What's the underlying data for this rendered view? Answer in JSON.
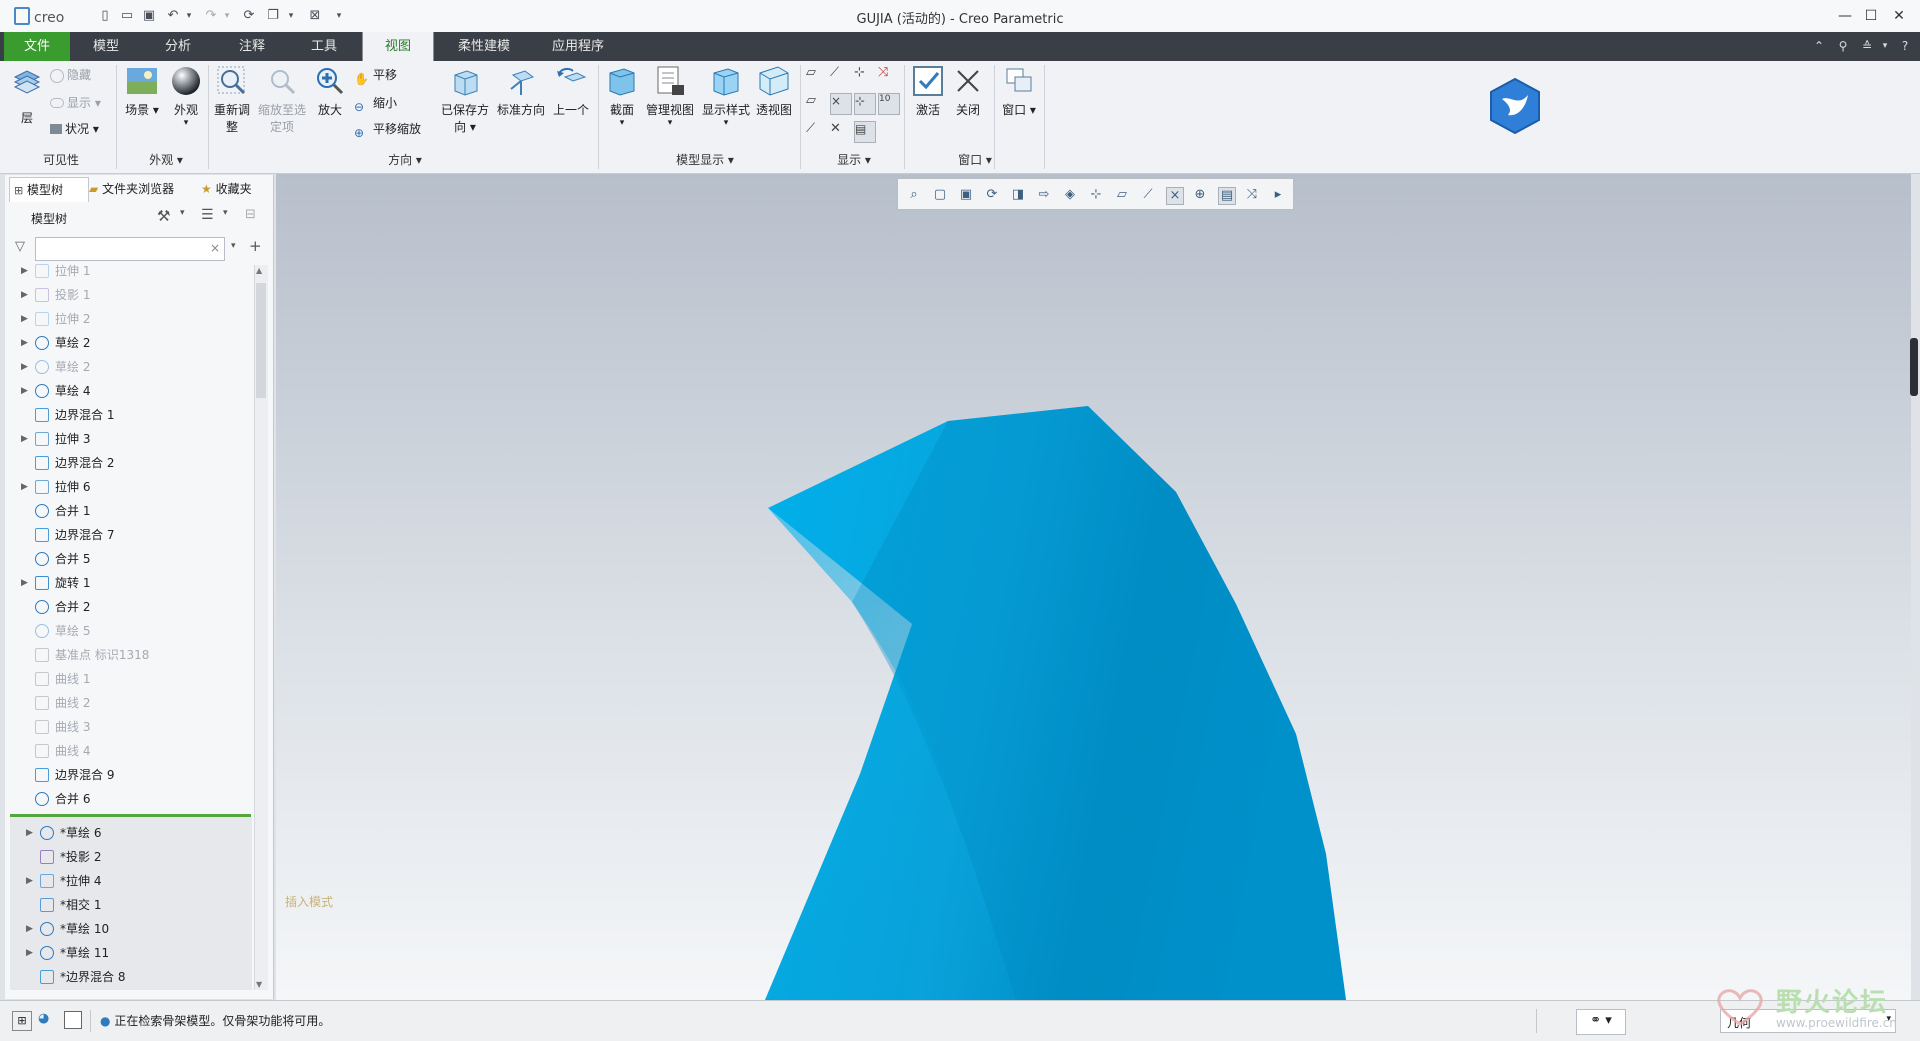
{
  "window": {
    "app_logo": "creo",
    "title": "GUJIA (活动的) - Creo Parametric"
  },
  "menu": {
    "tabs": [
      {
        "label": "文件"
      },
      {
        "label": "模型"
      },
      {
        "label": "分析"
      },
      {
        "label": "注释"
      },
      {
        "label": "工具"
      },
      {
        "label": "视图"
      },
      {
        "label": "柔性建模"
      },
      {
        "label": "应用程序"
      }
    ],
    "active_tab": "视图"
  },
  "ribbon": {
    "visibility": {
      "layer": "层",
      "hide": "隐藏",
      "show": "显示",
      "status": "状况",
      "group": "可见性"
    },
    "appearance": {
      "scene": "场景",
      "appearance": "外观",
      "group": "外观"
    },
    "orientation": {
      "refit_line1": "重新调",
      "refit_line2": "整",
      "zoom_selected_line1": "缩放至选",
      "zoom_selected_line2": "定项",
      "zoom_in": "放大",
      "pan": "平移",
      "zoom_out": "缩小",
      "pan_zoom": "平移缩放",
      "saved_line1": "已保存方",
      "saved_line2": "向",
      "standard": "标准方向",
      "previous": "上一个",
      "group": "方向"
    },
    "model_display": {
      "section": "截面",
      "manage_views": "管理视图",
      "display_style": "显示样式",
      "perspective": "透视图",
      "group": "模型显示"
    },
    "display": {
      "group": "显示"
    },
    "window_group": {
      "activate": "激活",
      "close": "关闭",
      "windows": "窗口",
      "group": "窗口"
    }
  },
  "left_panel": {
    "tabs": [
      {
        "label": "模型树"
      },
      {
        "label": "文件夹浏览器"
      },
      {
        "label": "收藏夹"
      }
    ],
    "header": "模型树",
    "tree": [
      {
        "label": "拉伸 1",
        "dim": true,
        "arrow": true,
        "icon": "extrude-icon"
      },
      {
        "label": "投影 1",
        "dim": true,
        "arrow": true,
        "icon": "projection-icon"
      },
      {
        "label": "拉伸 2",
        "dim": true,
        "arrow": true,
        "icon": "extrude-icon"
      },
      {
        "label": "草绘 2",
        "dim": false,
        "arrow": true,
        "icon": "sketch-icon"
      },
      {
        "label": "草绘 2",
        "dim": true,
        "arrow": true,
        "icon": "sketch-icon"
      },
      {
        "label": "草绘 4",
        "dim": false,
        "arrow": true,
        "icon": "sketch-icon"
      },
      {
        "label": "边界混合 1",
        "dim": false,
        "arrow": false,
        "icon": "boundary-blend-icon"
      },
      {
        "label": "拉伸 3",
        "dim": false,
        "arrow": true,
        "icon": "extrude-icon"
      },
      {
        "label": "边界混合 2",
        "dim": false,
        "arrow": false,
        "icon": "boundary-blend-icon"
      },
      {
        "label": "拉伸 6",
        "dim": false,
        "arrow": true,
        "icon": "extrude-icon"
      },
      {
        "label": "合并 1",
        "dim": false,
        "arrow": false,
        "icon": "merge-icon"
      },
      {
        "label": "边界混合 7",
        "dim": false,
        "arrow": false,
        "icon": "boundary-blend-icon"
      },
      {
        "label": "合并 5",
        "dim": false,
        "arrow": false,
        "icon": "merge-icon"
      },
      {
        "label": "旋转 1",
        "dim": false,
        "arrow": true,
        "icon": "revolve-icon"
      },
      {
        "label": "合并 2",
        "dim": false,
        "arrow": false,
        "icon": "merge-icon"
      },
      {
        "label": "草绘 5",
        "dim": true,
        "arrow": false,
        "icon": "sketch-icon"
      },
      {
        "label": "基准点 标识1318",
        "dim": true,
        "arrow": false,
        "icon": "datum-point-icon"
      },
      {
        "label": "曲线 1",
        "dim": true,
        "arrow": false,
        "icon": "curve-icon"
      },
      {
        "label": "曲线 2",
        "dim": true,
        "arrow": false,
        "icon": "curve-icon"
      },
      {
        "label": "曲线 3",
        "dim": true,
        "arrow": false,
        "icon": "curve-icon"
      },
      {
        "label": "曲线 4",
        "dim": true,
        "arrow": false,
        "icon": "curve-icon"
      },
      {
        "label": "边界混合 9",
        "dim": false,
        "arrow": false,
        "icon": "boundary-blend-icon"
      },
      {
        "label": "合并 6",
        "dim": false,
        "arrow": false,
        "icon": "merge-icon"
      }
    ],
    "tree_after_insert": [
      {
        "label": "*草绘 6",
        "arrow": true,
        "icon": "sketch-icon"
      },
      {
        "label": "*投影 2",
        "arrow": false,
        "icon": "projection-icon"
      },
      {
        "label": "*拉伸 4",
        "arrow": true,
        "icon": "extrude-icon"
      },
      {
        "label": "*相交 1",
        "arrow": false,
        "icon": "intersect-icon"
      },
      {
        "label": "*草绘 10",
        "arrow": true,
        "icon": "sketch-icon"
      },
      {
        "label": "*草绘 11",
        "arrow": true,
        "icon": "sketch-icon"
      },
      {
        "label": "*边界混合 8",
        "arrow": false,
        "icon": "boundary-blend-icon"
      }
    ]
  },
  "viewport": {
    "insert_mode": "插入模式",
    "model_color": "#00a6e0"
  },
  "status": {
    "message": "正在检索骨架模型。仅骨架功能将可用。",
    "filter_value": "几何"
  },
  "watermark": {
    "text": "野火论坛",
    "url": "www.proewildfire.cn"
  }
}
